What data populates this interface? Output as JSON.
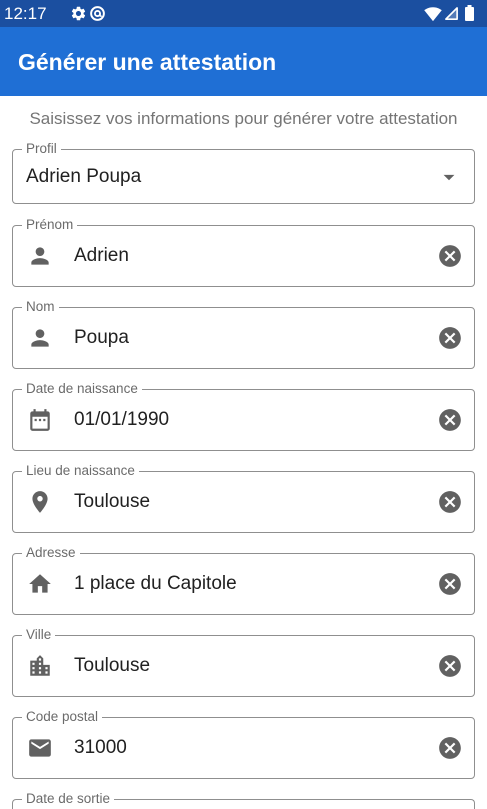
{
  "status_bar": {
    "time": "12:17",
    "icons": [
      "gear-icon",
      "circle-status-icon",
      "wifi-icon",
      "signal-icon",
      "battery-icon"
    ]
  },
  "app_bar": {
    "title": "Générer une attestation"
  },
  "form": {
    "intro": "Saisissez vos informations pour générer votre attestation",
    "profile": {
      "label": "Profil",
      "value": "Adrien Poupa",
      "icon": "arrow-drop-down-icon"
    },
    "fields": [
      {
        "label": "Prénom",
        "value": "Adrien",
        "icon": "person-icon"
      },
      {
        "label": "Nom",
        "value": "Poupa",
        "icon": "person-icon"
      },
      {
        "label": "Date de naissance",
        "value": "01/01/1990",
        "icon": "calendar-icon"
      },
      {
        "label": "Lieu de naissance",
        "value": "Toulouse",
        "icon": "location-pin-icon"
      },
      {
        "label": "Adresse",
        "value": "1 place du Capitole",
        "icon": "home-icon"
      },
      {
        "label": "Ville",
        "value": "Toulouse",
        "icon": "city-icon"
      },
      {
        "label": "Code postal",
        "value": "31000",
        "icon": "mail-icon"
      },
      {
        "label": "Date de sortie"
      }
    ],
    "clear_icon": "cancel-icon"
  },
  "colors": {
    "status_bar": "#1b4fa0",
    "app_bar": "#1f6fd5",
    "outline": "#8f8f8f",
    "label": "#6b6b6b",
    "icon": "#616161",
    "intro_text": "#757575"
  }
}
